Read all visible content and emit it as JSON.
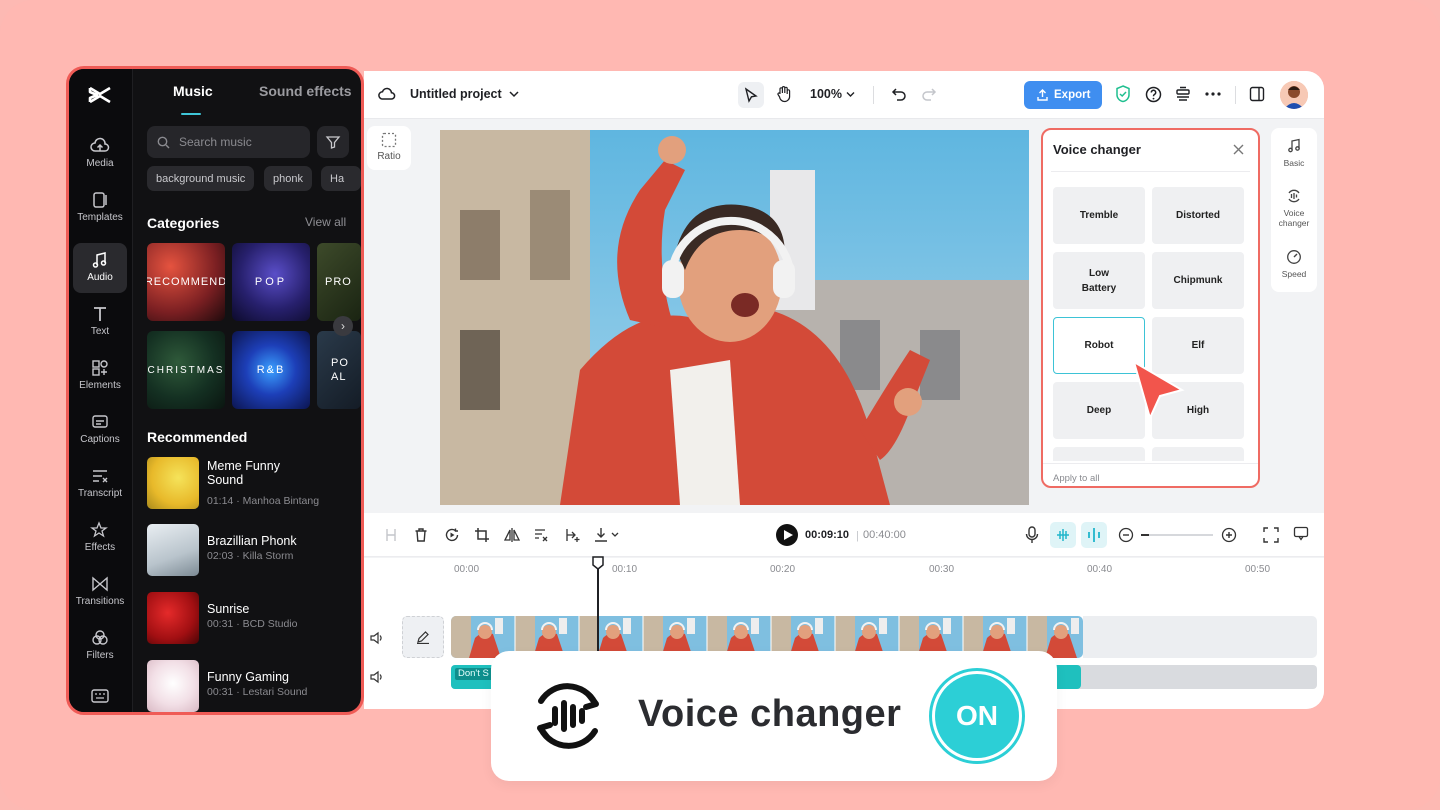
{
  "left_panel": {
    "rail": [
      {
        "label": "Media",
        "icon": "cloud-icon"
      },
      {
        "label": "Templates",
        "icon": "templates-icon"
      },
      {
        "label": "Audio",
        "icon": "music-note-icon",
        "active": true
      },
      {
        "label": "Text",
        "icon": "text-icon"
      },
      {
        "label": "Elements",
        "icon": "elements-icon"
      },
      {
        "label": "Captions",
        "icon": "captions-icon"
      },
      {
        "label": "Transcript",
        "icon": "transcript-icon"
      },
      {
        "label": "Effects",
        "icon": "effects-icon"
      },
      {
        "label": "Transitions",
        "icon": "transitions-icon"
      },
      {
        "label": "Filters",
        "icon": "filters-icon"
      }
    ],
    "tabs": {
      "music": "Music",
      "sound_effects": "Sound effects"
    },
    "search": {
      "placeholder": "Search music"
    },
    "chips": [
      "background music",
      "phonk",
      "Ha"
    ],
    "categories": {
      "heading": "Categories",
      "view_all": "View all",
      "items": [
        "RECOMMEND",
        "POP",
        "PRO",
        "CHRISTMAS",
        "R&B",
        "PO AL"
      ]
    },
    "recommended": {
      "heading": "Recommended",
      "items": [
        {
          "title": "Meme Funny Sound",
          "meta": "01:14 · Manhoa Bintang"
        },
        {
          "title": "Brazillian Phonk",
          "meta": "02:03 · Killa Storm"
        },
        {
          "title": "Sunrise",
          "meta": "00:31 · BCD Studio"
        },
        {
          "title": "Funny Gaming",
          "meta": "00:31 · Lestari Sound"
        }
      ]
    }
  },
  "topbar": {
    "project_title": "Untitled project",
    "zoom": "100%",
    "export_label": "Export"
  },
  "ratio_label": "Ratio",
  "voice_changer_panel": {
    "title": "Voice changer",
    "options": [
      "Tremble",
      "Distorted",
      "Low Battery",
      "Chipmunk",
      "Robot",
      "Elf",
      "Deep",
      "High"
    ],
    "selected": "Robot",
    "apply_all": "Apply to all"
  },
  "right_rail": [
    {
      "label": "Basic",
      "icon": "music-note-icon"
    },
    {
      "label": "Voice changer",
      "icon": "voice-changer-icon"
    },
    {
      "label": "Speed",
      "icon": "speed-icon"
    }
  ],
  "timeline": {
    "current_time": "00:09:10",
    "total_time": "00:40:00",
    "ruler": [
      "00:00",
      "00:10",
      "00:20",
      "00:30",
      "00:40",
      "00:50"
    ],
    "audio_clip_label": "Don't S"
  },
  "badge": {
    "label": "Voice changer",
    "toggle": "ON"
  },
  "colors": {
    "background": "#ffb8b2",
    "accent": "#2ccfd6",
    "highlight_border": "#ef5b56",
    "export_button": "#3f8ef0"
  }
}
